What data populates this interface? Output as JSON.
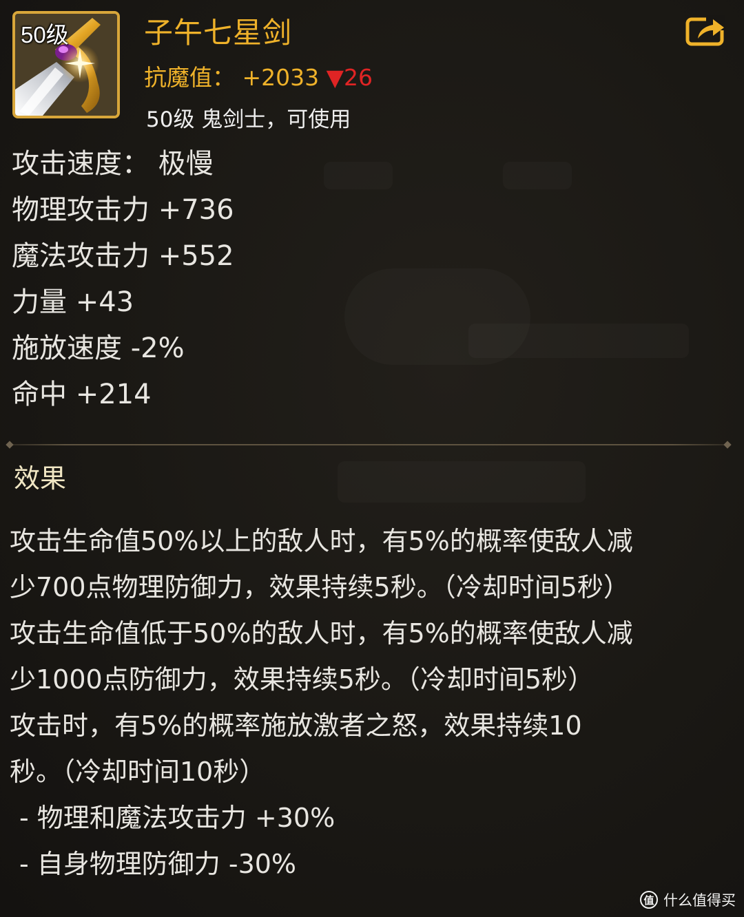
{
  "item": {
    "level_badge": "50级",
    "name": "子午七星剑",
    "resist_label": "抗魔值：",
    "resist_value": "+2033",
    "resist_change": "▼26",
    "class_requirement": "50级 鬼剑士，可使用"
  },
  "stats": [
    "攻击速度：  极慢",
    "物理攻击力 +736",
    "魔法攻击力 +552",
    "力量 +43",
    "施放速度 -2%",
    "命中 +214"
  ],
  "effects": {
    "title": "效果",
    "lines": [
      "攻击生命值50%以上的敌人时，有5%的概率使敌人减",
      "少700点物理防御力，效果持续5秒。（冷却时间5秒）",
      "攻击生命值低于50%的敌人时，有5%的概率使敌人减",
      "少1000点防御力，效果持续5秒。（冷却时间5秒）",
      "攻击时，有5%的概率施放激者之怒，效果持续10",
      "秒。（冷却时间10秒）",
      "- 物理和魔法攻击力 +30%",
      "- 自身物理防御力 -30%"
    ]
  },
  "watermark": {
    "logo_glyph": "值",
    "text": "什么值得买"
  },
  "colors": {
    "name_gold": "#efb22a",
    "down_red": "#e02424",
    "icon_border": "#d8a63a"
  },
  "icons": {
    "share": "share-icon",
    "item": "sword-icon"
  }
}
